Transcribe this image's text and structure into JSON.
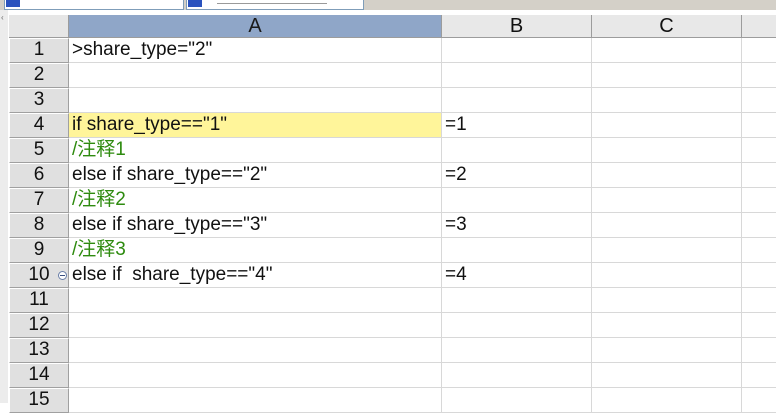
{
  "columns": [
    "A",
    "B",
    "C"
  ],
  "selected_column": "A",
  "rows": [
    {
      "num": "1",
      "a": ">share_type=\"2\"",
      "b": ""
    },
    {
      "num": "2",
      "a": "",
      "b": ""
    },
    {
      "num": "3",
      "a": "",
      "b": ""
    },
    {
      "num": "4",
      "a": "if share_type==\"1\"",
      "b": "=1",
      "highlight": true
    },
    {
      "num": "5",
      "a": "/注释1",
      "b": "",
      "comment": true
    },
    {
      "num": "6",
      "a": "else if share_type==\"2\"",
      "b": "=2"
    },
    {
      "num": "7",
      "a": "/注释2",
      "b": "",
      "comment": true
    },
    {
      "num": "8",
      "a": "else if share_type==\"3\"",
      "b": "=3"
    },
    {
      "num": "9",
      "a": "/注释3",
      "b": "",
      "comment": true
    },
    {
      "num": "10",
      "a": "else if  share_type==\"4\"",
      "b": "=4",
      "collapse": true
    },
    {
      "num": "11",
      "a": "",
      "b": ""
    },
    {
      "num": "12",
      "a": "",
      "b": ""
    },
    {
      "num": "13",
      "a": "",
      "b": ""
    },
    {
      "num": "14",
      "a": "",
      "b": ""
    },
    {
      "num": "15",
      "a": "",
      "b": ""
    }
  ],
  "colors": {
    "selected_header": "#8fa6c8",
    "highlight": "#fff59a",
    "comment_text": "#2e8b0f"
  },
  "icons": {
    "collapse": "collapse-group-icon"
  }
}
